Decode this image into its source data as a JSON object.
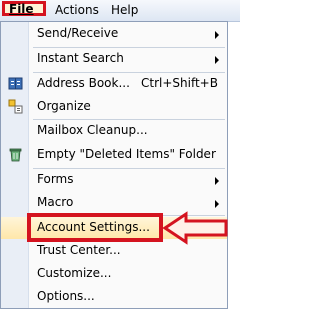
{
  "menubar": {
    "file": "File",
    "actions": "Actions",
    "help": "Help"
  },
  "menu": {
    "send_receive": "Send/Receive",
    "instant_search": "Instant Search",
    "address_book": "Address Book...",
    "address_book_shortcut": "Ctrl+Shift+B",
    "organize": "Organize",
    "mailbox_cleanup": "Mailbox Cleanup...",
    "empty_deleted": "Empty \"Deleted Items\" Folder",
    "forms": "Forms",
    "macro": "Macro",
    "account_settings": "Account Settings...",
    "trust_center": "Trust Center...",
    "customize": "Customize...",
    "options": "Options..."
  },
  "colors": {
    "highlight_box": "#d4131f",
    "hover_bg": "#ffe7a9",
    "gutter": "#e9eef6"
  },
  "icons": {
    "address_book": "address-book-icon",
    "organize": "organize-icon",
    "empty_deleted": "trash-icon",
    "annotation": "pointer-arrow-icon"
  }
}
